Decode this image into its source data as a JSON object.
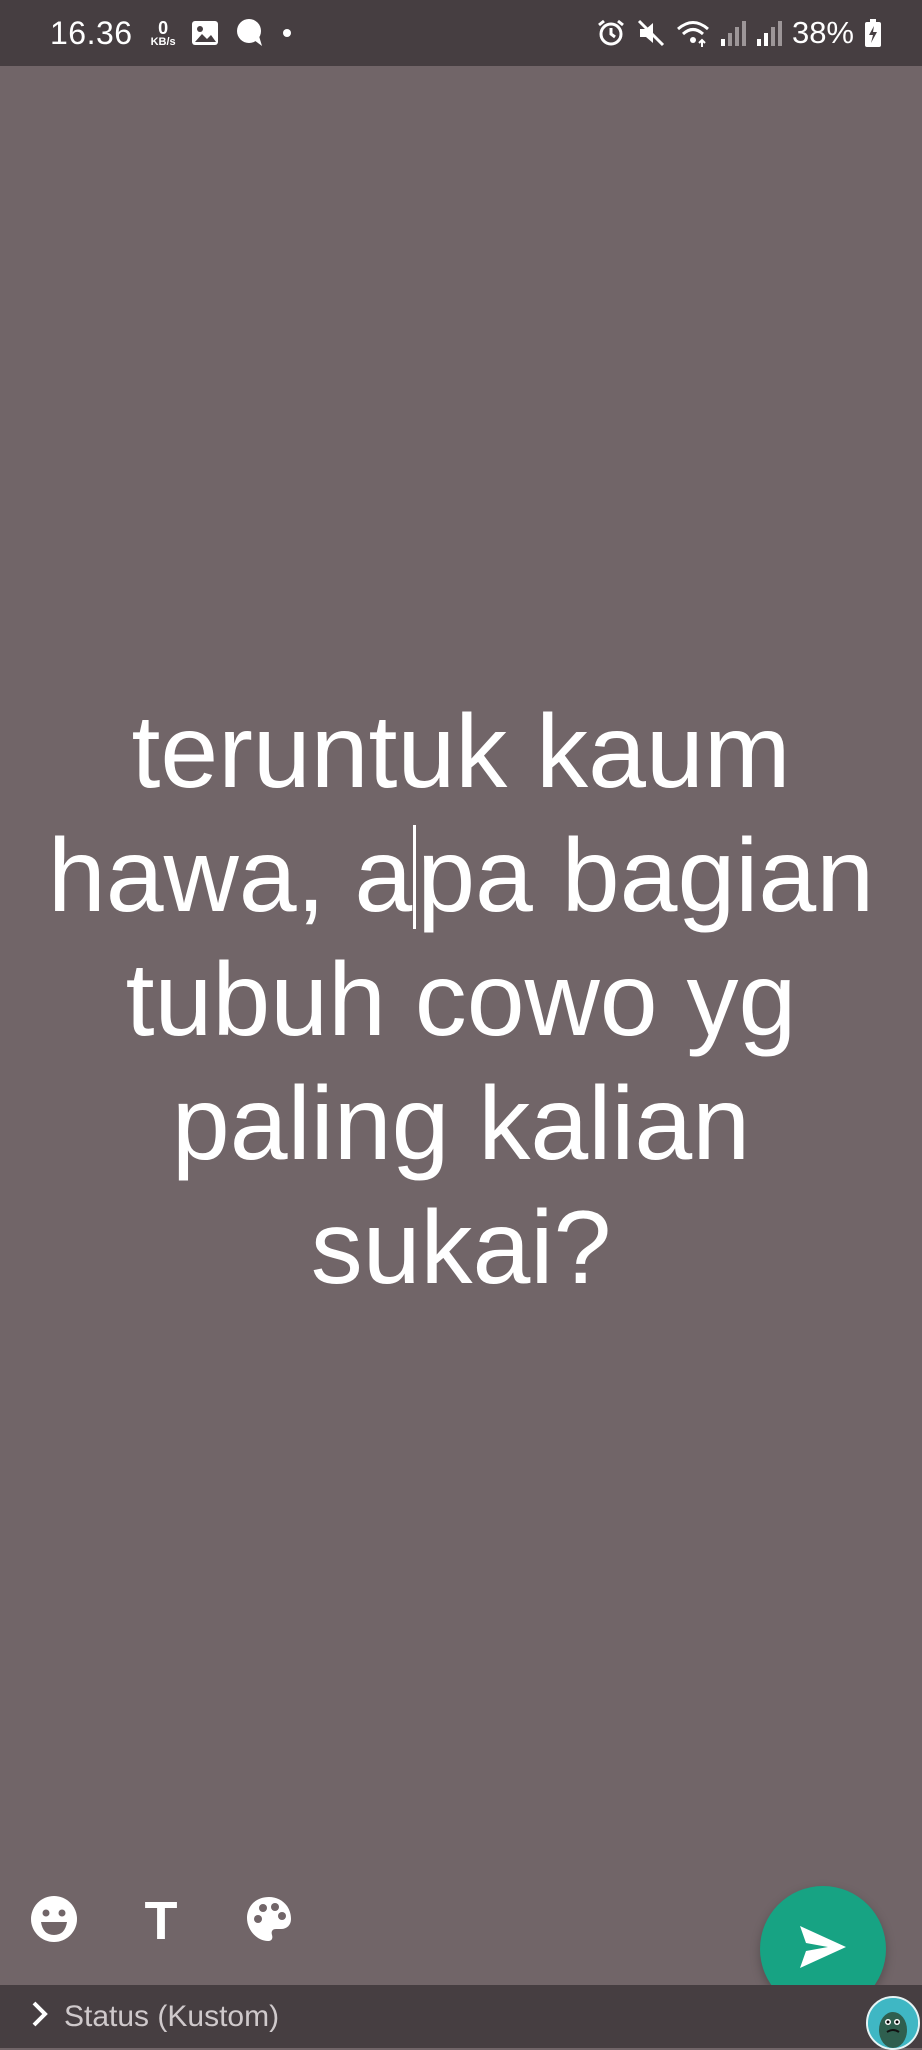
{
  "status_bar": {
    "time": "16.36",
    "net_speed_value": "0",
    "net_speed_unit": "KB/s",
    "battery_percent": "38%",
    "icons": [
      "gallery-icon",
      "chat-bubble-icon",
      "dot-icon",
      "alarm-icon",
      "mute-icon",
      "wifi-icon",
      "signal-icon",
      "signal-icon",
      "battery-charging-icon"
    ]
  },
  "editor": {
    "text_before_caret": "teruntuk kaum\nhawa, a",
    "text_after_caret": "pa bagian\ntubuh cowo yg\npaling kalian\nsukai?",
    "background_color": "#716568",
    "text_color": "#ffffff"
  },
  "tools": {
    "emoji_icon": "emoji-icon",
    "text_glyph": "T",
    "palette_icon": "palette-icon"
  },
  "send_button": {
    "icon": "send-icon",
    "color": "#17a383"
  },
  "footer": {
    "privacy_label": "Status (Kustom)",
    "chevron_icon": "chevron-right-icon",
    "avatar_icon": "avatar"
  }
}
